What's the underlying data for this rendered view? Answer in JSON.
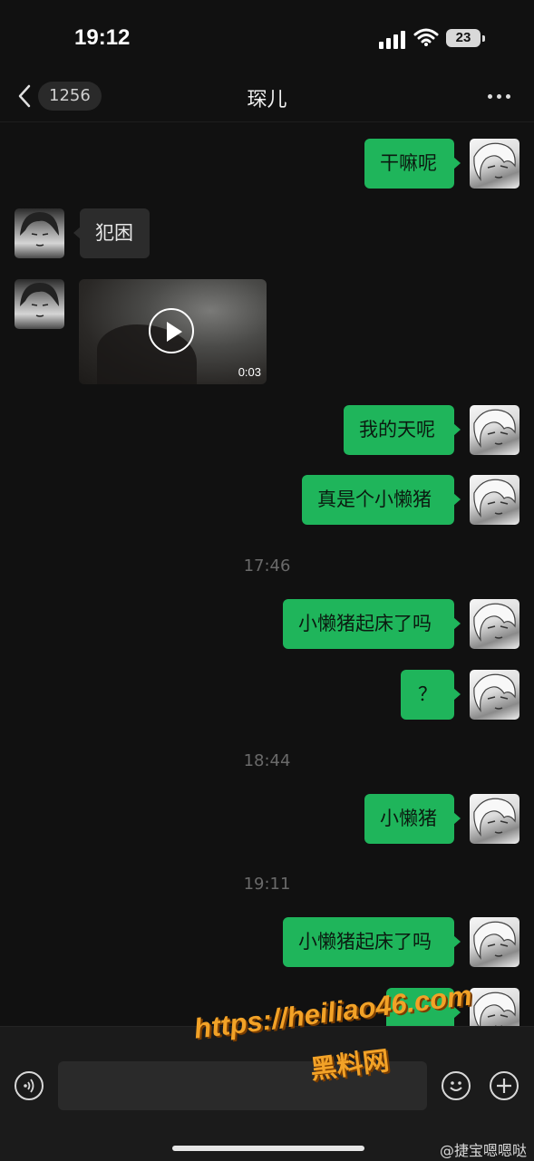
{
  "status_bar": {
    "time": "19:12",
    "battery": "23"
  },
  "header": {
    "back_badge": "1256",
    "title": "琛儿"
  },
  "messages": [
    {
      "side": "out",
      "text": "干嘛呢"
    },
    {
      "side": "in",
      "text": "犯困"
    },
    {
      "side": "in",
      "type": "video",
      "duration": "0:03"
    },
    {
      "side": "out",
      "text": "我的天呢"
    },
    {
      "side": "out",
      "text": "真是个小懒猪"
    },
    {
      "type": "timestamp",
      "text": "17:46"
    },
    {
      "side": "out",
      "text": "小懒猪起床了吗"
    },
    {
      "side": "out",
      "text": "？"
    },
    {
      "type": "timestamp",
      "text": "18:44"
    },
    {
      "side": "out",
      "text": "小懒猪"
    },
    {
      "type": "timestamp",
      "text": "19:11"
    },
    {
      "side": "out",
      "text": "小懒猪起床了吗"
    }
  ],
  "watermark": {
    "url": "https://heiliao46.com",
    "site_name": "黑料网"
  },
  "credit": "@捷宝嗯嗯哒"
}
